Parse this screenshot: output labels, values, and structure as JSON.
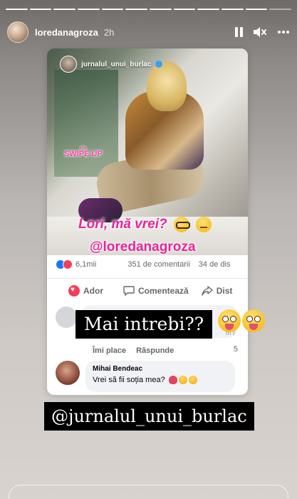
{
  "story": {
    "username": "loredanagroza",
    "time_ago": "2h",
    "segments_total": 12,
    "segments_done": 11
  },
  "post": {
    "mini_username": "jurnalul_unui_burlac",
    "swipe_up": "SWIPE UP",
    "caption_line1": "Lori, mă vrei?",
    "caption_handle": "@loredanagroza",
    "likes": "6,1mii",
    "comments": "351 de comentarii",
    "shares": "34 de dis",
    "actions": {
      "like": "Ador",
      "comment": "Comentează",
      "share": "Dist"
    },
    "comment1": {
      "faded_text": "m r",
      "like_label": "Îmi place",
      "reply_label": "Răspunde",
      "count": "5"
    },
    "comment2": {
      "name": "Mihai Bendeac",
      "text": "Vrei să fii soția mea?"
    }
  },
  "overlays": {
    "question": "Mai intrebi??",
    "mention": "@jurnalul_unui_burlac"
  },
  "colors": {
    "caption_pink": "#e8239a",
    "facebook_blue": "#1877f2",
    "love_red": "#f33e58"
  },
  "icons": [
    "pause-icon",
    "mute-icon",
    "more-icon",
    "like-icon",
    "love-icon",
    "comment-icon",
    "share-icon"
  ]
}
